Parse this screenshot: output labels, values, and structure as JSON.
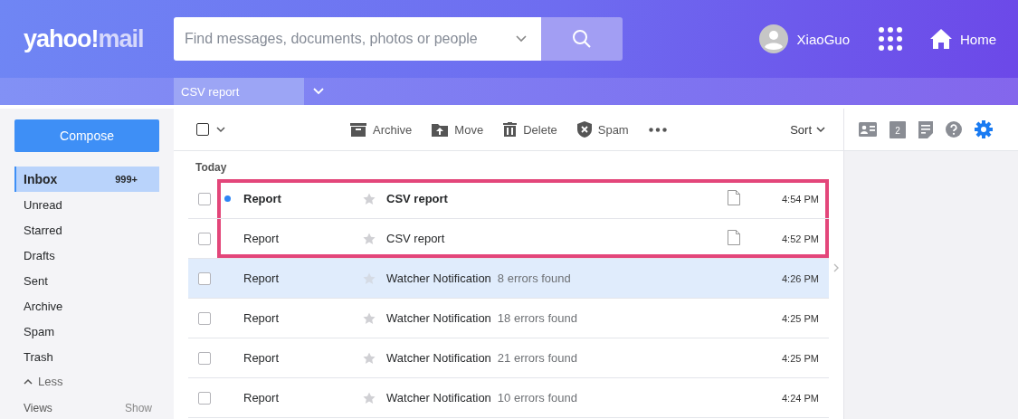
{
  "header": {
    "logo": {
      "main": "yahoo!",
      "accent": "mail"
    },
    "search": {
      "placeholder": "Find messages, documents, photos or people"
    },
    "user": "XiaoGuo",
    "home": "Home"
  },
  "subbar": {
    "tabs": [
      {
        "label": "CSV report",
        "selected": true
      }
    ]
  },
  "sidebar": {
    "compose": "Compose",
    "folders": [
      {
        "label": "Inbox",
        "count": "999+",
        "selected": true
      },
      {
        "label": "Unread",
        "selected": false
      },
      {
        "label": "Starred",
        "selected": false
      },
      {
        "label": "Drafts",
        "selected": false
      },
      {
        "label": "Sent",
        "selected": false
      },
      {
        "label": "Archive",
        "selected": false
      },
      {
        "label": "Spam",
        "selected": false
      },
      {
        "label": "Trash",
        "selected": false
      }
    ],
    "less": "Less",
    "views": "Views",
    "show": "Show"
  },
  "toolbar": {
    "select_all": {
      "checked": false
    },
    "actions": [
      {
        "kind": "archive",
        "label": "Archive"
      },
      {
        "kind": "move",
        "label": "Move"
      },
      {
        "kind": "delete",
        "label": "Delete"
      },
      {
        "kind": "spam",
        "label": "Spam"
      }
    ],
    "sort": "Sort"
  },
  "messages": {
    "group": "Today",
    "rows": [
      {
        "sender": "Report",
        "subject": "CSV report",
        "time": "4:54 PM",
        "unread": true,
        "attachment": true,
        "selected": false,
        "checked": false,
        "starred": false,
        "highlighted": true
      },
      {
        "sender": "Report",
        "subject": "CSV report",
        "time": "4:52 PM",
        "unread": false,
        "attachment": true,
        "selected": false,
        "checked": false,
        "starred": false,
        "highlighted": true
      },
      {
        "sender": "Report",
        "subject": "Watcher Notification",
        "snippet": "8 errors found",
        "time": "4:26 PM",
        "unread": false,
        "attachment": false,
        "selected": true,
        "checked": false,
        "starred": false,
        "highlighted": false
      },
      {
        "sender": "Report",
        "subject": "Watcher Notification",
        "snippet": "18 errors found",
        "time": "4:25 PM",
        "unread": false,
        "attachment": false,
        "selected": false,
        "checked": false,
        "starred": false,
        "highlighted": false
      },
      {
        "sender": "Report",
        "subject": "Watcher Notification",
        "snippet": "21 errors found",
        "time": "4:25 PM",
        "unread": false,
        "attachment": false,
        "selected": false,
        "checked": false,
        "starred": false,
        "highlighted": false
      },
      {
        "sender": "Report",
        "subject": "Watcher Notification",
        "snippet": "10 errors found",
        "time": "4:24 PM",
        "unread": false,
        "attachment": false,
        "selected": false,
        "checked": false,
        "starred": false,
        "highlighted": false
      }
    ]
  },
  "right_panel": {
    "badge": "2"
  }
}
